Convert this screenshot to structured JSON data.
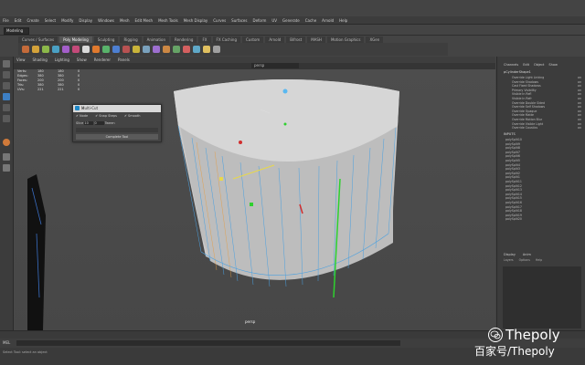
{
  "menubar": [
    "File",
    "Edit",
    "Create",
    "Select",
    "Modify",
    "Display",
    "Windows",
    "Mesh",
    "Edit Mesh",
    "Mesh Tools",
    "Mesh Display",
    "Curves",
    "Surfaces",
    "Deform",
    "UV",
    "Generate",
    "Cache",
    "Arnold",
    "Help"
  ],
  "mode": "Modeling",
  "shelf": {
    "tabs": [
      "Curves / Surfaces",
      "Poly Modeling",
      "Sculpting",
      "Rigging",
      "Animation",
      "Rendering",
      "FX",
      "FX Caching",
      "Custom",
      "Arnold",
      "Bifrost",
      "MASH",
      "Motion Graphics",
      "XGen"
    ],
    "active_tab": "Poly Modeling",
    "icon_colors": [
      "#c46b3a",
      "#d4a23a",
      "#8cb84a",
      "#4aa0c4",
      "#a35ec9",
      "#c44a7a",
      "#d9d9d9",
      "#e07a2e",
      "#59b36b",
      "#4d7fd1",
      "#b85252",
      "#c9b43a",
      "#7aa1bd",
      "#9d6fcf",
      "#cc8844",
      "#66a366",
      "#d46060",
      "#5fa8c7",
      "#e0c060",
      "#a0a0a0"
    ]
  },
  "viewport": {
    "menu": [
      "View",
      "Shading",
      "Lighting",
      "Show",
      "Renderer",
      "Panels"
    ],
    "camera": "persp",
    "hud": {
      "headers": [
        "",
        "",
        "",
        ""
      ],
      "rows": [
        {
          "label": "Verts:",
          "a": "180",
          "b": "180",
          "c": "0"
        },
        {
          "label": "Edges:",
          "a": "380",
          "b": "380",
          "c": "0"
        },
        {
          "label": "Faces:",
          "a": "200",
          "b": "200",
          "c": "0"
        },
        {
          "label": "Tris:",
          "a": "380",
          "b": "380",
          "c": "0"
        },
        {
          "label": "UVs:",
          "a": "221",
          "b": "221",
          "c": "0"
        }
      ]
    },
    "frame_marker": "persp"
  },
  "dialog": {
    "title": "Multi-Cut",
    "close": "×",
    "options": [
      "Node",
      "Snap Steps",
      "Smooth"
    ],
    "row_label": "Slice",
    "row_values": [
      "10",
      "0"
    ],
    "row_tail": "Tween",
    "button": "Complete Tool"
  },
  "channel_box": {
    "tabs": [
      "Channels",
      "Edit",
      "Object",
      "Show"
    ],
    "node": "pCylinderShape1",
    "attributes": [
      {
        "name": "Override Light Linking",
        "value": "on"
      },
      {
        "name": "Override Shadows",
        "value": "on"
      },
      {
        "name": "Cast Fixed Shadows",
        "value": "on"
      },
      {
        "name": "Primary Visibility",
        "value": "on"
      },
      {
        "name": "Visible In Refl",
        "value": "on"
      },
      {
        "name": "Visible In Refr",
        "value": "on"
      },
      {
        "name": "Override Double Sided",
        "value": "on"
      },
      {
        "name": "Override Self Shadows",
        "value": "on"
      },
      {
        "name": "Override Opaque",
        "value": "on"
      },
      {
        "name": "Override Matte",
        "value": "on"
      },
      {
        "name": "Override Motion Blur",
        "value": "on"
      },
      {
        "name": "Override Visible Light",
        "value": "on"
      },
      {
        "name": "Override Caustics",
        "value": "on"
      }
    ],
    "inputs_title": "INPUTS",
    "inputs": [
      "polySplit10",
      "polySplit9",
      "polySplit8",
      "polySplit7",
      "polySplit6",
      "polySplit5",
      "polySplit4",
      "polySplit3",
      "polySplit2",
      "polySplit1",
      "polySplit11",
      "polySplit12",
      "polySplit13",
      "polySplit14",
      "polySplit15",
      "polySplit16",
      "polySplit17",
      "polySplit18",
      "polySplit19",
      "polySplit20"
    ]
  },
  "layers": {
    "tabs": [
      "Display",
      "Anim"
    ],
    "menu": [
      "Layers",
      "Options",
      "Help"
    ]
  },
  "cmd_label": "MEL",
  "help_text": "Select Tool: select an object",
  "watermark": {
    "brand": "Thepoly",
    "sub": "百家号/Thepoly"
  }
}
